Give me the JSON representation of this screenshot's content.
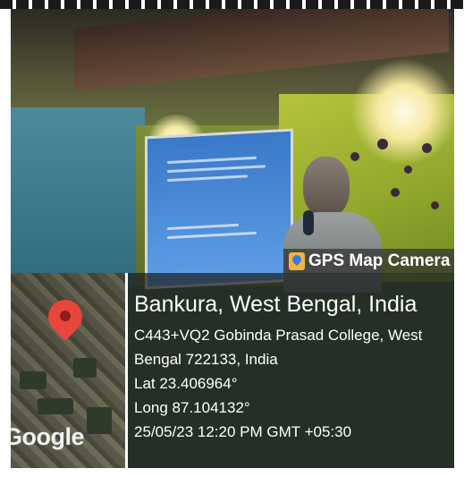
{
  "overlay": {
    "badge_text": "GPS Map Camera",
    "location_title": "Bankura, West Bengal, India",
    "address_line1": "C443+VQ2 Gobinda Prasad College, West",
    "address_line2": "Bengal 722133, India",
    "latitude": "Lat 23.406964°",
    "longitude": "Long 87.104132°",
    "datetime": "25/05/23 12:20 PM GMT +05:30",
    "map_label": "Google"
  },
  "icons": [
    "gps-map-camera-icon",
    "map-pin-icon"
  ],
  "colors": {
    "overlay_bg": "#1c1e1e",
    "pin": "#e8453c",
    "badge_icon": "#f3b63a",
    "text": "#ffffff"
  }
}
